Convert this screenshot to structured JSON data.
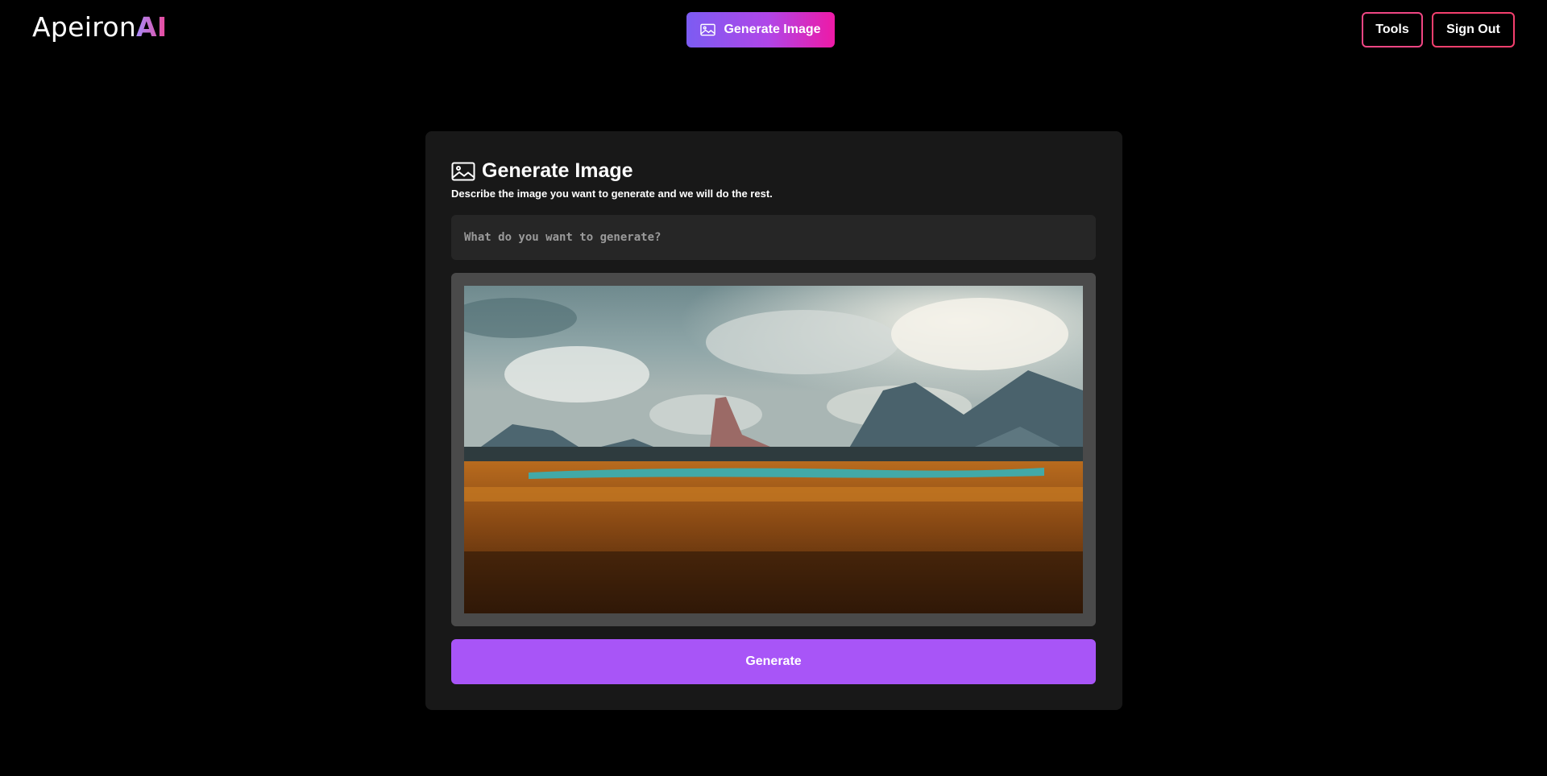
{
  "brand": {
    "name_prefix": "Apeiron",
    "name_suffix": "AI"
  },
  "nav": {
    "generate_image_label": "Generate Image",
    "tools_label": "Tools",
    "sign_out_label": "Sign Out"
  },
  "card": {
    "title": "Generate Image",
    "subtitle": "Describe the image you want to generate and we will do the rest.",
    "prompt_placeholder": "What do you want to generate?",
    "prompt_value": "",
    "generate_label": "Generate"
  },
  "colors": {
    "background": "#000000",
    "card": "#181818",
    "input": "#262626",
    "accent_purple": "#a855f7",
    "gradient_start": "#7c5cf2",
    "gradient_end": "#ee1aa6",
    "outline_pink": "#f04684"
  },
  "icons": {
    "nav_generate": "image-icon",
    "card_title": "image-icon"
  }
}
